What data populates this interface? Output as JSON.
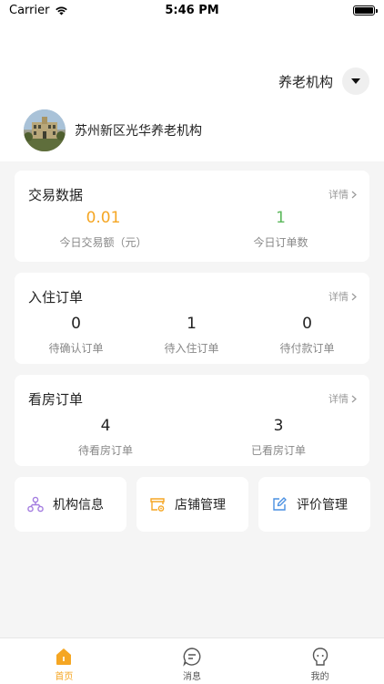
{
  "status_bar": {
    "carrier": "Carrier",
    "time": "5:46 PM",
    "battery_level": 1.0
  },
  "header": {
    "org_type_label": "养老机构",
    "org_name": "苏州新区光华养老机构"
  },
  "trade_card": {
    "title": "交易数据",
    "more": "详情",
    "stats": [
      {
        "value": "0.01",
        "label": "今日交易额（元）",
        "color": "#f5a623"
      },
      {
        "value": "1",
        "label": "今日订单数",
        "color": "#5cb85c"
      }
    ]
  },
  "checkin_card": {
    "title": "入住订单",
    "more": "详情",
    "stats": [
      {
        "value": "0",
        "label": "待确认订单"
      },
      {
        "value": "1",
        "label": "待入住订单"
      },
      {
        "value": "0",
        "label": "待付款订单"
      }
    ]
  },
  "viewing_card": {
    "title": "看房订单",
    "more": "详情",
    "stats": [
      {
        "value": "4",
        "label": "待看房订单"
      },
      {
        "value": "3",
        "label": "已看房订单"
      }
    ]
  },
  "quick_actions": [
    {
      "label": "机构信息",
      "icon": "org-structure-icon",
      "color": "#a47de0"
    },
    {
      "label": "店铺管理",
      "icon": "store-settings-icon",
      "color": "#f5a623"
    },
    {
      "label": "评价管理",
      "icon": "edit-review-icon",
      "color": "#4a90e2"
    }
  ],
  "tab_bar": {
    "tabs": [
      {
        "label": "首页",
        "icon": "home-icon",
        "active": true
      },
      {
        "label": "消息",
        "icon": "message-icon",
        "active": false
      },
      {
        "label": "我的",
        "icon": "profile-icon",
        "active": false
      }
    ],
    "accent_color": "#f5a623"
  }
}
